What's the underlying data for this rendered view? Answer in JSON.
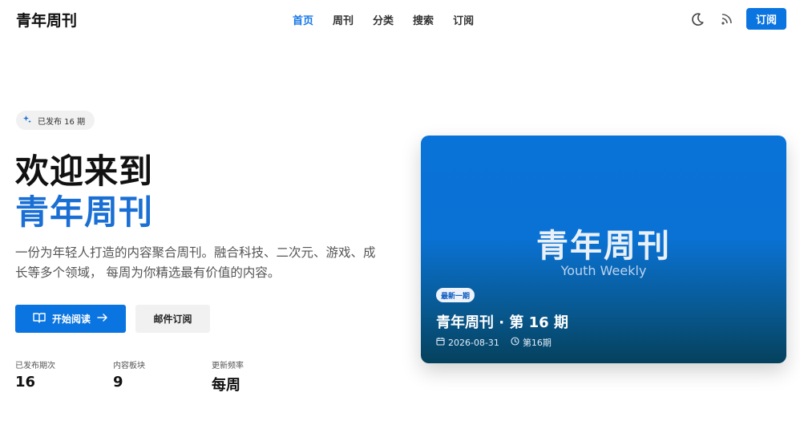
{
  "brand": "青年周刊",
  "nav": {
    "links": [
      "首页",
      "周刊",
      "分类",
      "搜索",
      "订阅"
    ],
    "subscribe_label": "订阅",
    "icons": [
      "moon-icon",
      "rss-icon"
    ]
  },
  "hero": {
    "pill": "已发布 16 期",
    "title_line1": "欢迎来到",
    "title_line2": "青年周刊",
    "lead": "一份为年轻人打造的内容聚合周刊。融合科技、二次元、游戏、成长等多个领域， 每周为你精选最有价值的内容。",
    "primary_button": "开始阅读",
    "secondary_button": "邮件订阅",
    "stats": [
      {
        "label": "已发布期次",
        "value": "16"
      },
      {
        "label": "内容板块",
        "value": "9"
      },
      {
        "label": "更新频率",
        "value": "每周"
      }
    ]
  },
  "card": {
    "title": "青年周刊",
    "subtitle": "Youth Weekly",
    "badge": "最新一期",
    "issue_title": "青年周刊 · 第 16 期",
    "date": "2026-08-31",
    "issue_tag": "第16期"
  },
  "colors": {
    "accent": "#0a74e0",
    "title_blue": "#1a6fd4",
    "card_top": "#0a73d9",
    "card_bottom": "#05415d"
  }
}
